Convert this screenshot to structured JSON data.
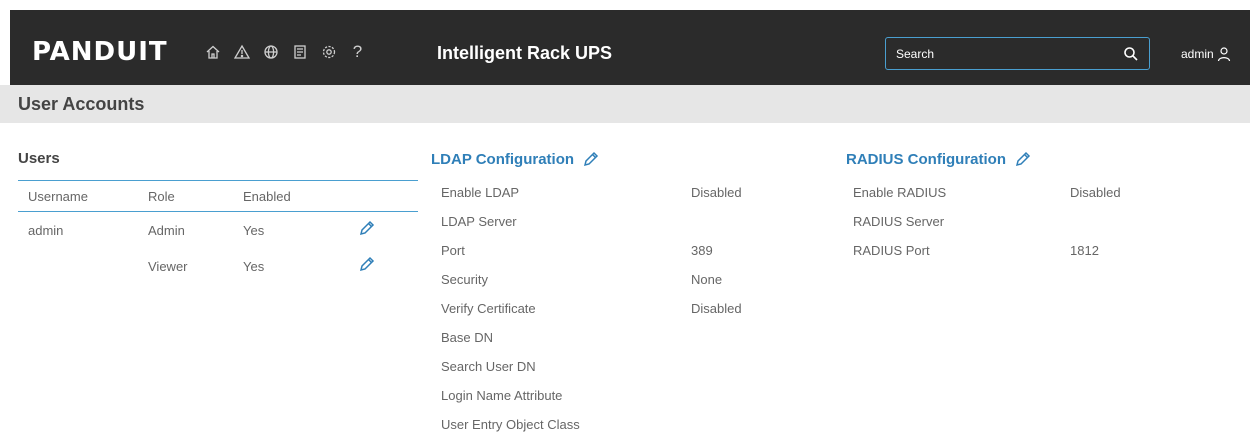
{
  "header": {
    "logo_text": "PANDUIT",
    "app_title": "Intelligent Rack UPS",
    "search_placeholder": "Search",
    "user_label": "admin",
    "nav_icons": [
      "home-icon",
      "alert-icon",
      "globe-icon",
      "document-icon",
      "settings-icon",
      "help-icon"
    ],
    "help_glyph": "?"
  },
  "page": {
    "title": "User Accounts"
  },
  "users": {
    "title": "Users",
    "columns": [
      "Username",
      "Role",
      "Enabled"
    ],
    "rows": [
      {
        "username": "admin",
        "role": "Admin",
        "enabled": "Yes"
      },
      {
        "username": "",
        "role": "Viewer",
        "enabled": "Yes"
      }
    ]
  },
  "ldap": {
    "title": "LDAP Configuration",
    "fields": [
      {
        "label": "Enable LDAP",
        "value": "Disabled"
      },
      {
        "label": "LDAP Server",
        "value": ""
      },
      {
        "label": "Port",
        "value": "389"
      },
      {
        "label": "Security",
        "value": "None"
      },
      {
        "label": "Verify Certificate",
        "value": "Disabled"
      },
      {
        "label": "Base DN",
        "value": ""
      },
      {
        "label": "Search User DN",
        "value": ""
      },
      {
        "label": "Login Name Attribute",
        "value": ""
      },
      {
        "label": "User Entry Object Class",
        "value": ""
      }
    ]
  },
  "radius": {
    "title": "RADIUS Configuration",
    "fields": [
      {
        "label": "Enable RADIUS",
        "value": "Disabled"
      },
      {
        "label": "RADIUS Server",
        "value": ""
      },
      {
        "label": "RADIUS Port",
        "value": "1812"
      }
    ]
  },
  "colors": {
    "accent": "#2f7fb8",
    "topbar": "#2b2b2b",
    "header_band": "#e6e6e6"
  }
}
